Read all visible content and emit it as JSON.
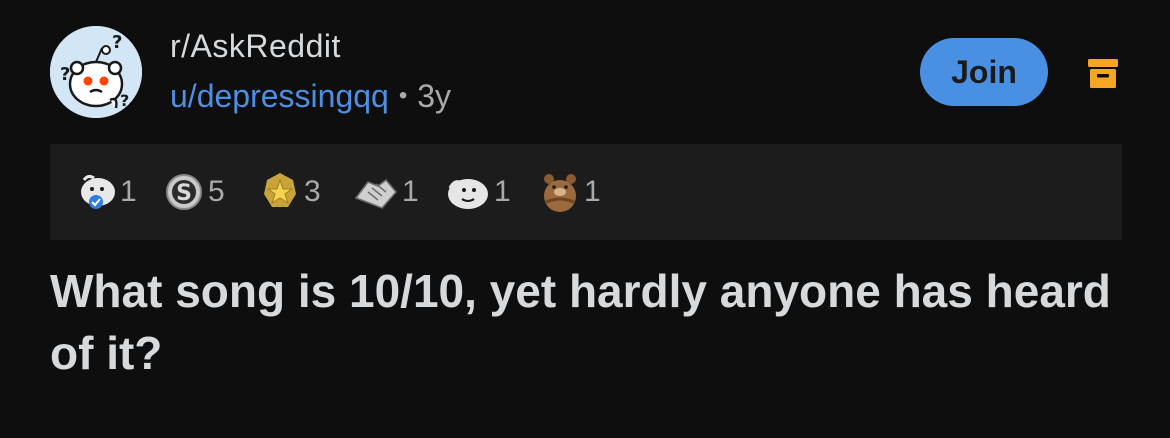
{
  "post": {
    "subreddit": "r/AskReddit",
    "author": "u/depressingqq",
    "separator": "•",
    "age": "3y",
    "title": "What song is 10/10, yet hardly anyone has heard of it?"
  },
  "actions": {
    "join_label": "Join"
  },
  "awards": [
    {
      "icon": "wholesome-seal-icon",
      "count": "1"
    },
    {
      "icon": "silver-coin-icon",
      "count": "5"
    },
    {
      "icon": "gold-star-icon",
      "count": "3"
    },
    {
      "icon": "handshake-icon",
      "count": "1"
    },
    {
      "icon": "helpful-face-icon",
      "count": "1"
    },
    {
      "icon": "bear-hug-icon",
      "count": "1"
    }
  ],
  "colors": {
    "background": "#0e0e0f",
    "awards_bar": "#1c1c1d",
    "accent_blue": "#4a90e2",
    "user_link": "#4f8fe0",
    "archive_orange": "#f5a623"
  }
}
